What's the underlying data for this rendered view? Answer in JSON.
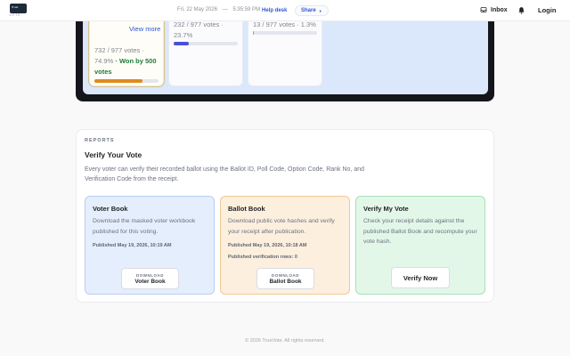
{
  "header": {
    "logo_text": "Trust",
    "logo_tag": "VOTE",
    "date": "Fri, 22 May 2026",
    "separator": "—",
    "time": "5:35:59 PM",
    "helpdesk_label": "Help desk",
    "share_label": "Share",
    "inbox_label": "Inbox",
    "login_label": "Login"
  },
  "results": {
    "view_more_label": "View more",
    "options": [
      {
        "votes_text": "732 / 977 votes ·",
        "pct_text": "74.9%",
        "won_text": " · Won by 500 votes",
        "progress": 0.749,
        "bar_color": "#e08a1e"
      },
      {
        "votes_text": "232 / 977 votes ·",
        "pct_text": "23.7%",
        "progress": 0.237,
        "bar_color": "#4b4fd6"
      },
      {
        "votes_text": "13 / 977 votes · 1.3%",
        "progress": 0.013,
        "bar_color": "#9aa0a6"
      }
    ]
  },
  "reports": {
    "kicker": "REPORTS",
    "title": "Verify Your Vote",
    "description": "Every voter can verify their recorded ballot using the Ballot ID, Poll Code, Option Code, Rank No, and Verification Code from the receipt.",
    "voter_book": {
      "title": "Voter Book",
      "description": "Download the masked voter workbook published for this voting.",
      "published": "Published May 19, 2026, 10:19 AM",
      "download_kicker": "DOWNLOAD",
      "download_label": "Voter Book"
    },
    "ballot_book": {
      "title": "Ballot Book",
      "description": "Download public vote hashes and verify your receipt after publication.",
      "published": "Published May 19, 2026, 10:18 AM",
      "rows": "Published verification rows: 0",
      "download_kicker": "DOWNLOAD",
      "download_label": "Ballot Book"
    },
    "verify": {
      "title": "Verify My Vote",
      "description": "Check your receipt details against the published Ballot Book and recompute your vote hash.",
      "button_label": "Verify Now"
    }
  },
  "footer": {
    "text": "© 2026 TrueVote. All rights reserved."
  },
  "colors": {
    "accent": "#2857d8",
    "won": "#1f7a3a"
  }
}
